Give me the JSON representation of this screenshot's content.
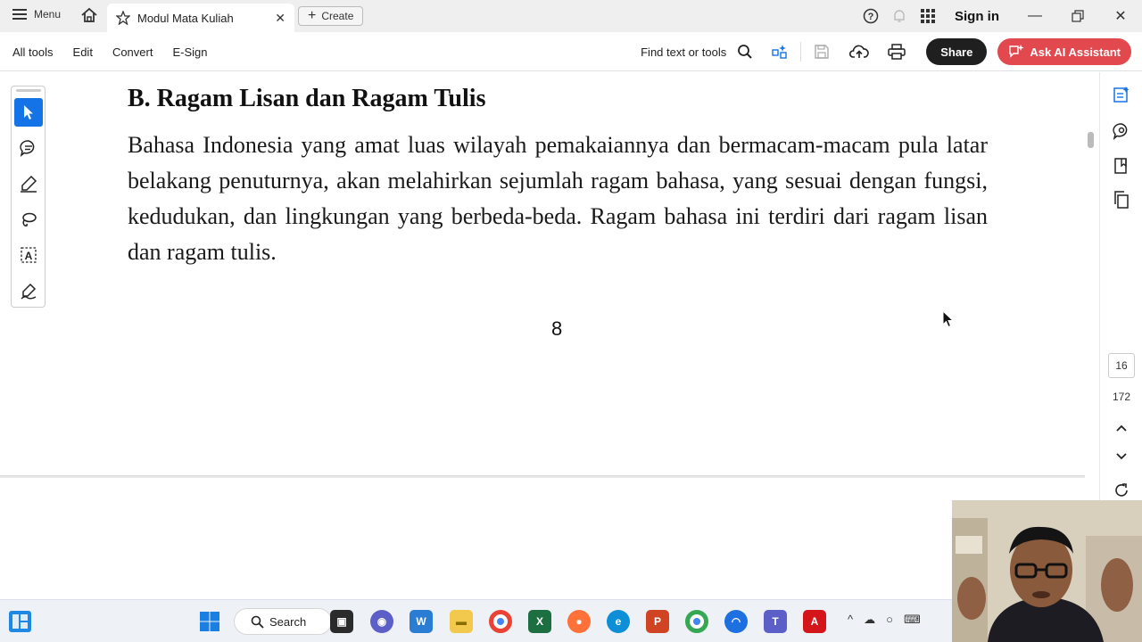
{
  "titlebar": {
    "menu_label": "Menu",
    "tab_title": "Modul Mata Kuliah",
    "create_label": "Create",
    "sign_in": "Sign in"
  },
  "toolbar": {
    "menus": [
      "All tools",
      "Edit",
      "Convert",
      "E-Sign"
    ],
    "find_label": "Find text or tools",
    "share_label": "Share",
    "ai_label": "Ask AI Assistant"
  },
  "document": {
    "heading": "B. Ragam Lisan dan Ragam Tulis",
    "paragraph": "Bahasa Indonesia yang amat luas wilayah pemakaiannya dan bermacam-macam pula latar belakang penuturnya, akan melahirkan sejumlah ragam bahasa, yang sesuai dengan fungsi, kedudukan, dan lingkungan yang berbeda-beda. Ragam bahasa ini terdiri dari ragam lisan dan ragam tulis.",
    "page_number": "8"
  },
  "navigation": {
    "current_page": "16",
    "total_pages": "172"
  },
  "left_tools": [
    "select-icon",
    "comment-icon",
    "highlight-pen-icon",
    "lasso-icon",
    "text-select-icon",
    "sign-icon"
  ],
  "right_tools": [
    "edit-pdf-icon",
    "comments-icon",
    "bookmark-icon",
    "pages-icon"
  ],
  "taskbar": {
    "search_label": "Search",
    "apps": [
      "task-view",
      "teams-chat",
      "word",
      "file-explorer",
      "chrome",
      "excel",
      "firefox",
      "edge",
      "powerpoint",
      "chrome",
      "arc",
      "teams",
      "acrobat"
    ]
  },
  "colors": {
    "accent_blue": "#1473e6",
    "ai_button": "#e2494f",
    "share_button": "#1f1f1f"
  }
}
